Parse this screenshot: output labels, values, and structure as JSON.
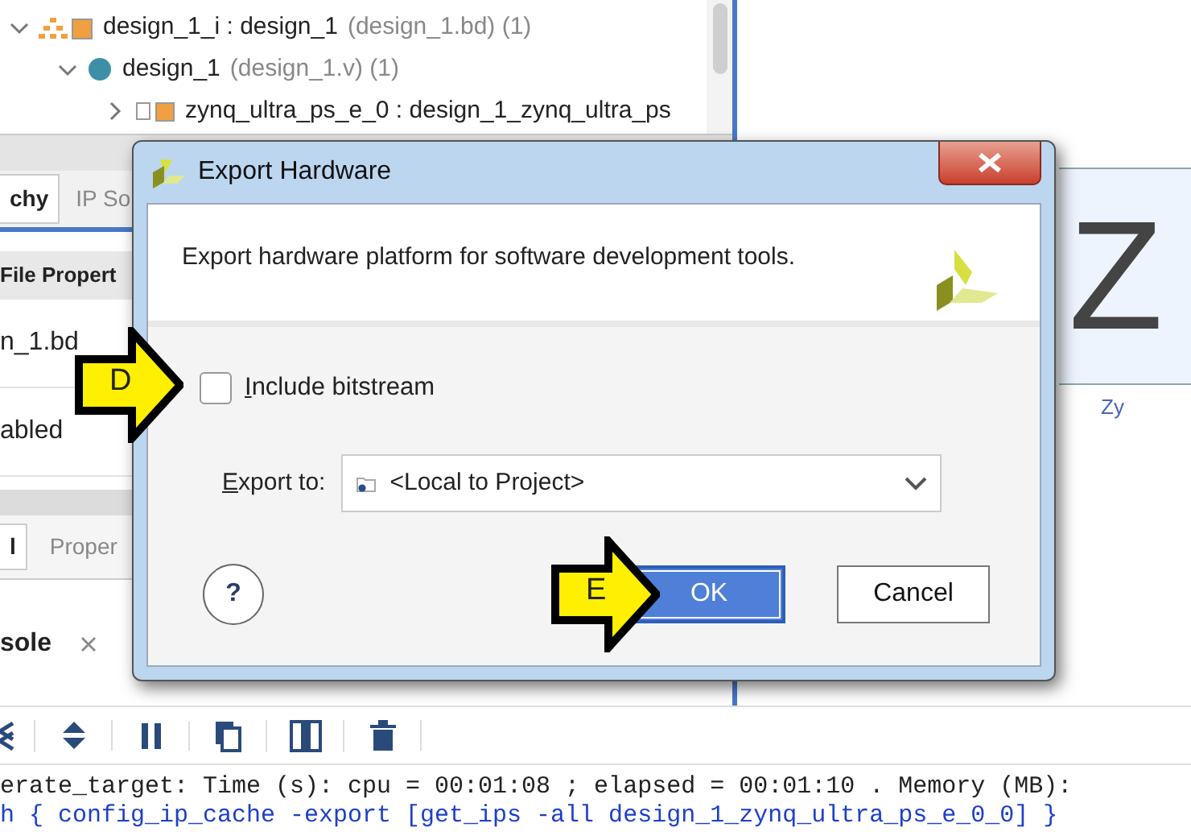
{
  "hierarchy_tree": {
    "items": [
      {
        "name": "design_1_i : design_1",
        "detail": "(design_1.bd) (1)",
        "expanded": true,
        "children": [
          {
            "name": "design_1",
            "detail": "(design_1.v) (1)",
            "expanded": true,
            "children": [
              {
                "name": "zynq_ultra_ps_e_0 : design_1_zynq_ultra_ps",
                "expanded": false
              }
            ]
          }
        ]
      }
    ]
  },
  "source_tabs": [
    {
      "label": "chy",
      "selected": true
    },
    {
      "label": "IP So",
      "selected": false
    }
  ],
  "properties": {
    "header": "File Propert",
    "rows": [
      "n_1.bd",
      "abled"
    ]
  },
  "bottom_tabs": [
    {
      "label": "l",
      "selected": true
    },
    {
      "label": "Proper",
      "selected": false
    }
  ],
  "console": {
    "tab": "sole",
    "lines": [
      {
        "text": "erate_target: Time (s): cpu = 00:01:08 ; elapsed = 00:01:10 . Memory (MB):",
        "kind": "output"
      },
      {
        "text": "h { config_ip_cache -export [get_ips -all design_1_zynq_ultra_ps_e_0_0] }",
        "kind": "command"
      }
    ]
  },
  "preview": {
    "text": "Z",
    "caption": "Zy"
  },
  "dialog": {
    "title": "Export Hardware",
    "description": "Export hardware platform for software development tools.",
    "include_bitstream": {
      "label": "Include bitstream",
      "checked": false
    },
    "export_to": {
      "label": "Export to:",
      "value": "<Local to Project>"
    },
    "help": "?",
    "buttons": [
      {
        "label": "OK",
        "kind": "primary"
      },
      {
        "label": "Cancel",
        "kind": "secondary"
      }
    ]
  },
  "callouts": [
    {
      "label": "D"
    },
    {
      "label": "E"
    }
  ]
}
